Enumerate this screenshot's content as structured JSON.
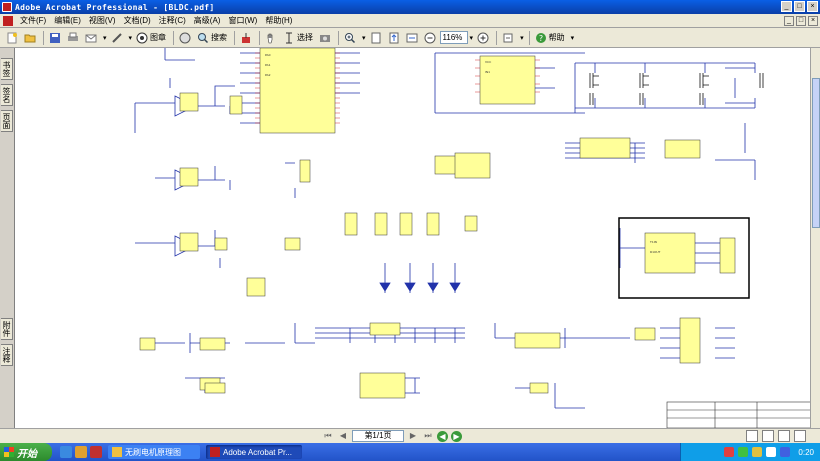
{
  "window": {
    "title": "Adobe Acrobat Professional - [BLDC.pdf]",
    "controls": [
      "_",
      "□",
      "×"
    ]
  },
  "menu": {
    "items": [
      "文件(F)",
      "编辑(E)",
      "视图(V)",
      "文档(D)",
      "注释(C)",
      "高级(A)",
      "窗口(W)",
      "帮助(H)"
    ],
    "doc_controls": [
      "_",
      "□",
      "×"
    ]
  },
  "toolbar": {
    "stamp_label": "图章",
    "search_label": "搜索",
    "select_label": "选择",
    "zoom_value": "116%",
    "help_label": "帮助"
  },
  "side_tabs": [
    "书签",
    "签名",
    "页面",
    "附件",
    "注释"
  ],
  "status": {
    "page": "第1/1页"
  },
  "taskbar": {
    "start_label": "开始",
    "tasks": [
      "无刷电机原理图",
      "Adobe Acrobat Pr..."
    ],
    "clock": "0:20"
  },
  "colors": {
    "accent": "#0a5fe6",
    "component_fill": "#ffff99",
    "wire": "#2233aa",
    "pin_red": "#cc0000"
  }
}
